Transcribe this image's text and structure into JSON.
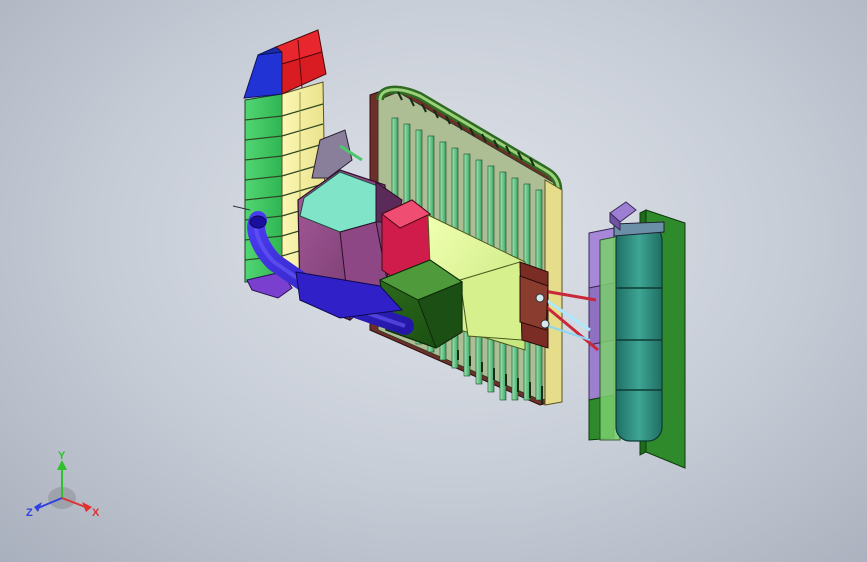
{
  "viewport": {
    "background_colors": [
      "#dfe3ea",
      "#c6ccd6",
      "#a9b0bd"
    ]
  },
  "triad": {
    "x_label": "X",
    "y_label": "Y",
    "z_label": "Z",
    "x_color": "#e03030",
    "y_color": "#2fbf2f",
    "z_color": "#3040e0"
  },
  "model": {
    "components": [
      "left-tower",
      "back-radiator-panel",
      "purple-housing",
      "red-block",
      "green-motor-block",
      "yellow-green-hopper",
      "blue-tube",
      "strut-links",
      "right-plate",
      "teal-cylinder-stack",
      "purple-blocks",
      "bracket-top-right"
    ]
  }
}
